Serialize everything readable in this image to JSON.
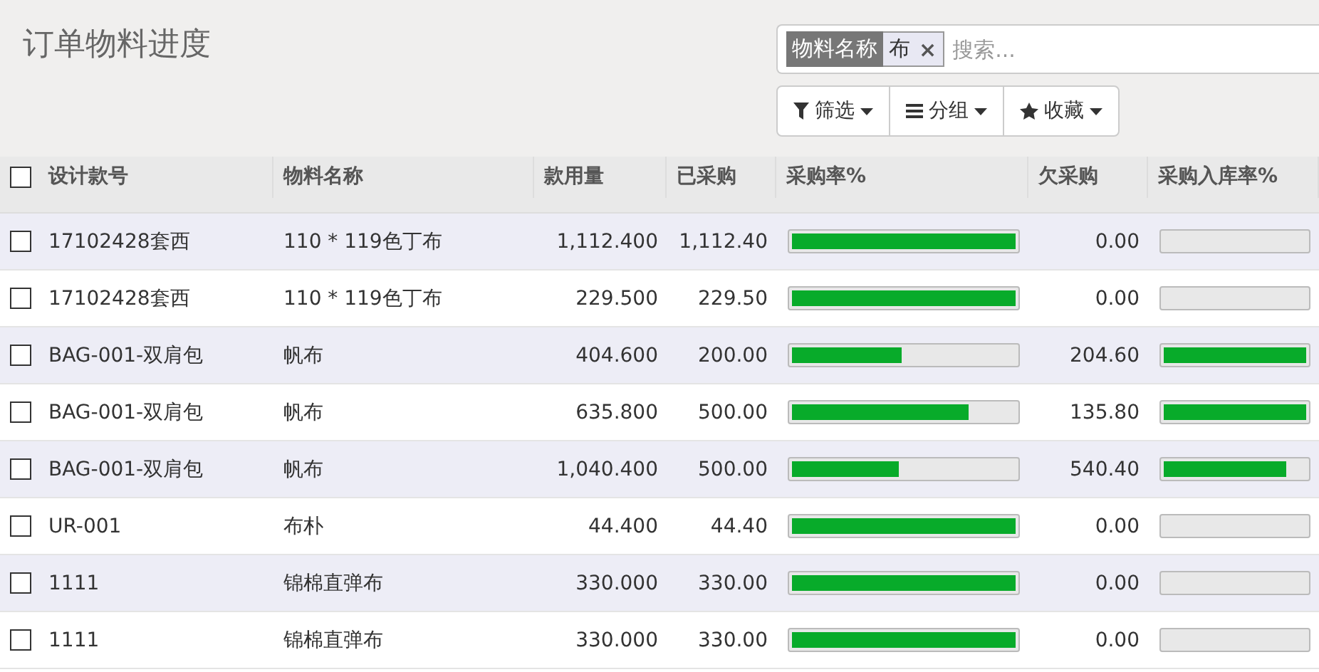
{
  "title": "订单物料进度",
  "search": {
    "facet": {
      "label": "物料名称",
      "value": "布",
      "remove": "×"
    },
    "placeholder": "搜索..."
  },
  "buttons": [
    {
      "kind": "filter",
      "label": "筛选"
    },
    {
      "kind": "group",
      "label": "分组"
    },
    {
      "kind": "favorite",
      "label": "收藏"
    }
  ],
  "table": {
    "select_all": {
      "checked": false
    },
    "columns": [
      "设计款号",
      "物料名称",
      "款用量",
      "已采购",
      "采购率%",
      "欠采购",
      "采购入库率%"
    ],
    "rows": [
      {
        "checked": false,
        "style": "17102428套西",
        "material": "110 * 119色丁布",
        "usage": "1,112.400",
        "purchased": "1,112.40",
        "rate": {
          "level": 1
        },
        "owed": "0.00",
        "inbound": {
          "level": 0
        }
      },
      {
        "checked": false,
        "style": "17102428套西",
        "material": "110 * 119色丁布",
        "usage": "229.500",
        "purchased": "229.50",
        "rate": {
          "level": 1
        },
        "owed": "0.00",
        "inbound": {
          "level": 0
        }
      },
      {
        "checked": false,
        "style": "BAG-001-双肩包",
        "material": "帆布",
        "usage": "404.600",
        "purchased": "200.00",
        "rate": {
          "level": 0.49
        },
        "owed": "204.60",
        "inbound": {
          "level": 1
        }
      },
      {
        "checked": false,
        "style": "BAG-001-双肩包",
        "material": "帆布",
        "usage": "635.800",
        "purchased": "500.00",
        "rate": {
          "level": 0.79
        },
        "owed": "135.80",
        "inbound": {
          "level": 1
        }
      },
      {
        "checked": false,
        "style": "BAG-001-双肩包",
        "material": "帆布",
        "usage": "1,040.400",
        "purchased": "500.00",
        "rate": {
          "level": 0.48
        },
        "owed": "540.40",
        "inbound": {
          "level": 0.86
        }
      },
      {
        "checked": false,
        "style": "UR-001",
        "material": "布朴",
        "usage": "44.400",
        "purchased": "44.40",
        "rate": {
          "level": 1
        },
        "owed": "0.00",
        "inbound": {
          "level": 0
        }
      },
      {
        "checked": false,
        "style": "1111",
        "material": "锦棉直弹布",
        "usage": "330.000",
        "purchased": "330.00",
        "rate": {
          "level": 1
        },
        "owed": "0.00",
        "inbound": {
          "level": 0
        }
      },
      {
        "checked": false,
        "style": "1111",
        "material": "锦棉直弹布",
        "usage": "330.000",
        "purchased": "330.00",
        "rate": {
          "level": 1
        },
        "owed": "0.00",
        "inbound": {
          "level": 0
        }
      }
    ]
  }
}
